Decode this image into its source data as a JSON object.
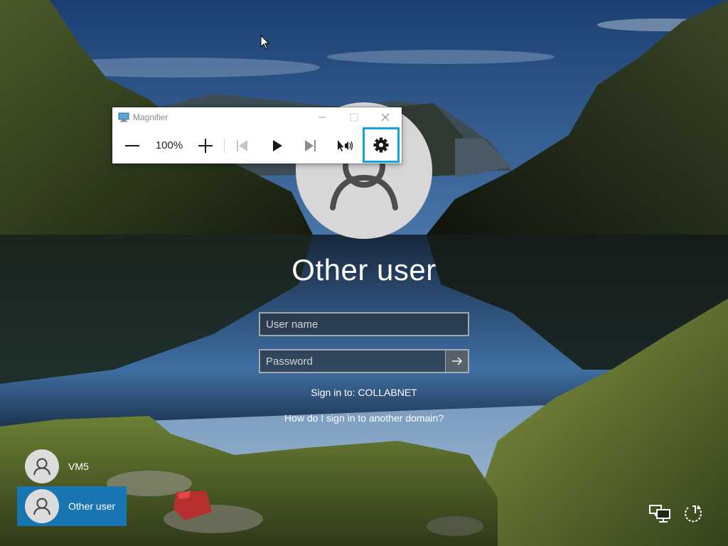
{
  "magnifier": {
    "title": "Magnifier",
    "zoom_level": "100%",
    "icons": {
      "app": "magnifier-app-icon",
      "minimize": "minimize-icon",
      "maximize": "maximize-icon",
      "close": "close-icon",
      "zoom_out": "minus-icon",
      "zoom_in": "plus-icon",
      "previous": "skip-previous-icon",
      "play": "play-icon",
      "next": "skip-next-icon",
      "read_from_here": "read-from-here-icon",
      "settings": "gear-icon"
    },
    "accent_color": "#12a3dd"
  },
  "signin": {
    "title": "Other user",
    "username_placeholder": "User name",
    "password_placeholder": "Password",
    "sign_in_to": "Sign in to: COLLABNET",
    "domain_help_link": "How do I sign in to another domain?"
  },
  "users": [
    {
      "name": "VM5",
      "selected": false
    },
    {
      "name": "Other user",
      "selected": true
    }
  ],
  "colors": {
    "selected_user": "#1a75b3"
  },
  "system_icons": [
    "network-icon",
    "ease-of-access-icon"
  ]
}
